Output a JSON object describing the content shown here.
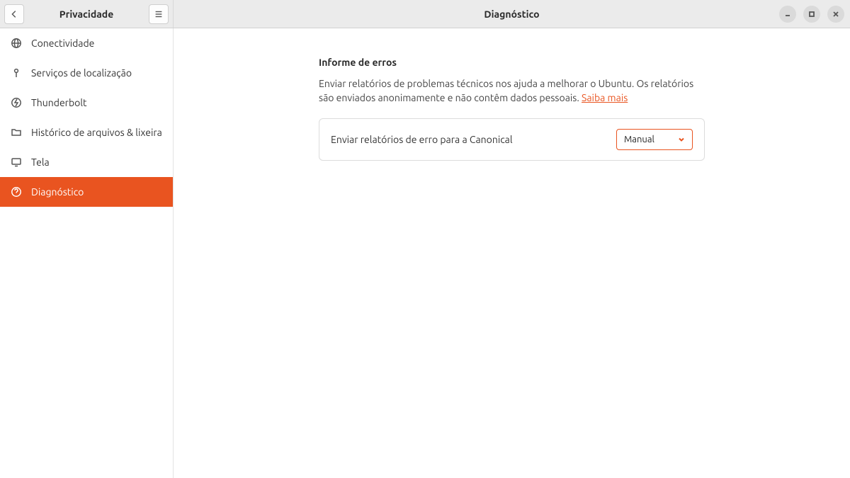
{
  "header": {
    "left_title": "Privacidade",
    "right_title": "Diagnóstico"
  },
  "sidebar": {
    "items": [
      {
        "label": "Conectividade",
        "icon": "globe-icon",
        "active": false
      },
      {
        "label": "Serviços de localização",
        "icon": "location-icon",
        "active": false
      },
      {
        "label": "Thunderbolt",
        "icon": "thunderbolt-icon",
        "active": false
      },
      {
        "label": "Histórico de arquivos & lixeira",
        "icon": "folder-icon",
        "active": false
      },
      {
        "label": "Tela",
        "icon": "display-icon",
        "active": false
      },
      {
        "label": "Diagnóstico",
        "icon": "help-icon",
        "active": true
      }
    ]
  },
  "main": {
    "section_title": "Informe de erros",
    "section_desc_before": "Enviar relatórios de problemas técnicos nos ajuda a melhorar o Ubuntu. Os relatórios são enviados anonimamente e não contêm dados pessoais. ",
    "section_link": "Saiba mais",
    "card_label": "Enviar relatórios de erro para a Canonical",
    "dropdown_value": "Manual"
  },
  "colors": {
    "accent": "#e95420"
  }
}
